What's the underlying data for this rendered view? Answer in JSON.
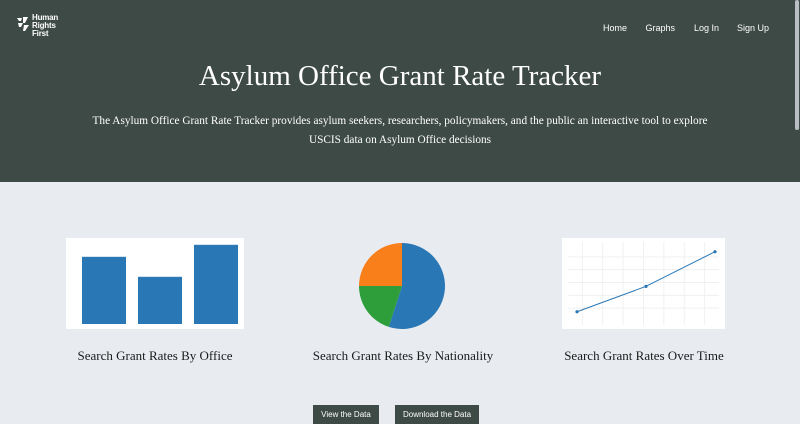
{
  "logo": {
    "lines": [
      "Human",
      "Rights",
      "First"
    ],
    "icon": "hrf-logo-mark"
  },
  "nav": {
    "items": [
      {
        "label": "Home",
        "name": "nav-home"
      },
      {
        "label": "Graphs",
        "name": "nav-graphs"
      },
      {
        "label": "Log In",
        "name": "nav-log-in"
      },
      {
        "label": "Sign Up",
        "name": "nav-sign-up"
      }
    ]
  },
  "hero": {
    "title": "Asylum Office Grant Rate Tracker",
    "description": "The Asylum Office Grant Rate Tracker provides asylum seekers, researchers, policymakers, and the public an interactive tool to explore USCIS data on Asylum Office decisions"
  },
  "colors": {
    "header_bg": "#3e4a45",
    "page_bg": "#e8ecf1",
    "bar_blue": "#2a77b5",
    "pie_blue": "#2a77b5",
    "pie_orange": "#f97f1b",
    "pie_green": "#2e9e3a",
    "line_blue": "#2a77b5"
  },
  "cards": [
    {
      "label": "Search Grant Rates By Office",
      "thumbnail": {
        "type": "bar",
        "values": [
          0.84,
          0.59,
          0.99
        ]
      }
    },
    {
      "label": "Search Grant Rates By Nationality",
      "thumbnail": {
        "type": "pie",
        "values": [
          0.55,
          0.2,
          0.25
        ]
      }
    },
    {
      "label": "Search Grant Rates Over Time",
      "thumbnail": {
        "type": "line",
        "values": [
          0.12,
          0.45,
          0.9
        ]
      }
    }
  ],
  "buttons": {
    "view_data": "View the Data",
    "download_data": "Download the Data"
  }
}
